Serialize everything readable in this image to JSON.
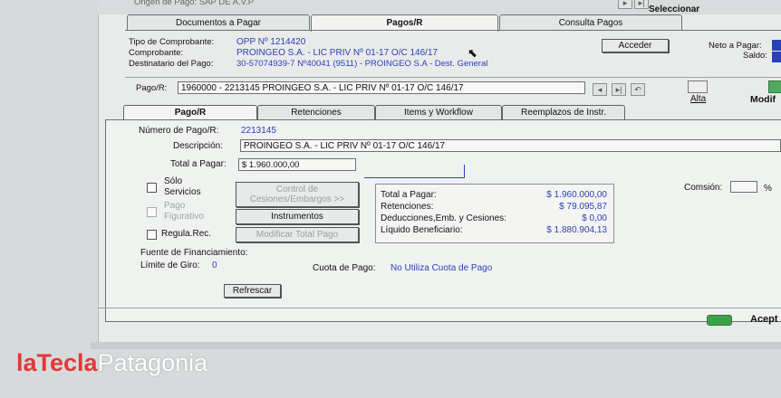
{
  "window": {
    "origin_label": "Origen de Pago: SAP DE A.V.P",
    "select_label": "Seleccionar"
  },
  "top_tabs": [
    {
      "label": "Documentos a Pagar"
    },
    {
      "label": "Pagos/R"
    },
    {
      "label": "Consulta Pagos"
    }
  ],
  "header": {
    "tipo_label": "Tipo de Comprobante:",
    "tipo_value": "OPP Nº 1214420",
    "comprobante_label": "Comprobante:",
    "comprobante_value": "PROINGEO S.A. - LIC PRIV Nº 01-17 O/C 146/17",
    "destinatario_label": "Destinatario del Pago:",
    "destinatario_value": "30-57074939-7 Nº40041 (9511) - PROINGEO S.A - Dest. General",
    "acceder_label": "Acceder",
    "neto_label": "Neto a Pagar:",
    "saldo_label": "Saldo:"
  },
  "pago_selector": {
    "label": "Pago/R:",
    "value": "1960000 - 2213145 PROINGEO S.A. - LIC PRIV Nº 01-17 O/C 146/17",
    "alta_label": "Alta",
    "modif_label": "Modif"
  },
  "inner_tabs": [
    {
      "label": "Pago/R"
    },
    {
      "label": "Retenciones"
    },
    {
      "label": "Items y Workflow"
    },
    {
      "label": "Reemplazos de Instr."
    }
  ],
  "form": {
    "numero_label": "Número de Pago/R:",
    "numero_value": "2213145",
    "descripcion_label": "Descripción:",
    "descripcion_value": "PROINGEO S.A. - LIC PRIV Nº 01-17 O/C 146/17",
    "total_label": "Total a Pagar:",
    "total_value": "$ 1.960.000,00",
    "solo_servicios_label_1": "Sólo",
    "solo_servicios_label_2": "Servicios",
    "pago_figurativo_label_1": "Pago",
    "pago_figurativo_label_2": "Figurativo",
    "regula_label": "Regula.Rec.",
    "control_label_1": "Control de",
    "control_label_2": "Cesiones/Embargos >>",
    "instrumentos_label": "Instrumentos",
    "modificar_label": "Modificar Total Pago",
    "comision_label": "Comsión:",
    "percent": "%",
    "fuente_label": "Fuente de Financiamiento:",
    "limite_label": "Límite de Giro:",
    "limite_value": "0",
    "cuota_label": "Cuota de Pago:",
    "cuota_value": "No Utiliza Cuota de Pago",
    "refrescar_label": "Refrescar"
  },
  "summary": {
    "rows": [
      {
        "label": "Total a Pagar:",
        "value": "$ 1.960.000,00"
      },
      {
        "label": "Retenciones:",
        "value": "$ 79.095,87"
      },
      {
        "label": "Deducciones,Emb. y Cesiones:",
        "value": "$ 0,00"
      },
      {
        "label": "Líquido Beneficiario:",
        "value": "$ 1.880.904,13"
      }
    ]
  },
  "footer": {
    "accept_label": "Acept"
  },
  "watermark": {
    "part1": "laTecla",
    "part2": "Patagonia"
  },
  "colors": {
    "value_blue": "#2a3fb8",
    "accept_green": "#3aa34a",
    "watermark_red": "#e2383b"
  }
}
